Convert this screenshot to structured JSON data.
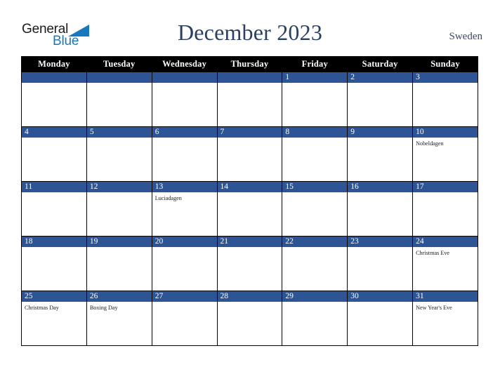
{
  "brand": {
    "name_part1": "General",
    "name_part2": "Blue",
    "triangle_color": "#1878be"
  },
  "header": {
    "title": "December 2023",
    "country": "Sweden",
    "title_color": "#2b3f63"
  },
  "calendar": {
    "weekday_headers": [
      "Monday",
      "Tuesday",
      "Wednesday",
      "Thursday",
      "Friday",
      "Saturday",
      "Sunday"
    ],
    "header_bg": "#000000",
    "daynum_bg": "#2d5596",
    "weeks": [
      [
        {
          "day": "",
          "event": ""
        },
        {
          "day": "",
          "event": ""
        },
        {
          "day": "",
          "event": ""
        },
        {
          "day": "",
          "event": ""
        },
        {
          "day": "1",
          "event": ""
        },
        {
          "day": "2",
          "event": ""
        },
        {
          "day": "3",
          "event": ""
        }
      ],
      [
        {
          "day": "4",
          "event": ""
        },
        {
          "day": "5",
          "event": ""
        },
        {
          "day": "6",
          "event": ""
        },
        {
          "day": "7",
          "event": ""
        },
        {
          "day": "8",
          "event": ""
        },
        {
          "day": "9",
          "event": ""
        },
        {
          "day": "10",
          "event": "Nobeldagen"
        }
      ],
      [
        {
          "day": "11",
          "event": ""
        },
        {
          "day": "12",
          "event": ""
        },
        {
          "day": "13",
          "event": "Luciadagen"
        },
        {
          "day": "14",
          "event": ""
        },
        {
          "day": "15",
          "event": ""
        },
        {
          "day": "16",
          "event": ""
        },
        {
          "day": "17",
          "event": ""
        }
      ],
      [
        {
          "day": "18",
          "event": ""
        },
        {
          "day": "19",
          "event": ""
        },
        {
          "day": "20",
          "event": ""
        },
        {
          "day": "21",
          "event": ""
        },
        {
          "day": "22",
          "event": ""
        },
        {
          "day": "23",
          "event": ""
        },
        {
          "day": "24",
          "event": "Christmas Eve"
        }
      ],
      [
        {
          "day": "25",
          "event": "Christmas Day"
        },
        {
          "day": "26",
          "event": "Boxing Day"
        },
        {
          "day": "27",
          "event": ""
        },
        {
          "day": "28",
          "event": ""
        },
        {
          "day": "29",
          "event": ""
        },
        {
          "day": "30",
          "event": ""
        },
        {
          "day": "31",
          "event": "New Year's Eve"
        }
      ]
    ]
  }
}
